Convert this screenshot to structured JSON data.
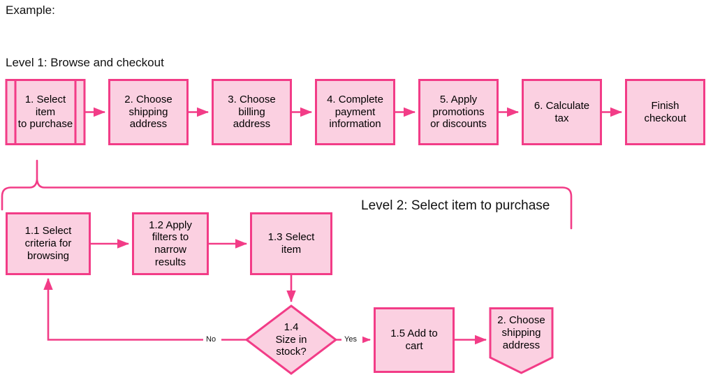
{
  "page": {
    "example_label": "Example:",
    "colors": {
      "shape_fill": "#FBD0E1",
      "shape_stroke": "#F23C87",
      "connector": "#F23C87",
      "text": "#000000",
      "background": "#FFFFFF"
    }
  },
  "level1": {
    "title": "Level 1: Browse and checkout",
    "nodes": [
      {
        "id": "l1-n1",
        "label": "1. Select item\nto purchase",
        "shape": "predefined-process"
      },
      {
        "id": "l1-n2",
        "label": "2. Choose\nshipping\naddress",
        "shape": "process"
      },
      {
        "id": "l1-n3",
        "label": "3. Choose\nbilling\naddress",
        "shape": "process"
      },
      {
        "id": "l1-n4",
        "label": "4. Complete\npayment\ninformation",
        "shape": "process"
      },
      {
        "id": "l1-n5",
        "label": "5. Apply\npromotions\nor discounts",
        "shape": "process"
      },
      {
        "id": "l1-n6",
        "label": "6. Calculate\ntax",
        "shape": "process"
      },
      {
        "id": "l1-n7",
        "label": "Finish\ncheckout",
        "shape": "process"
      }
    ]
  },
  "level2": {
    "title": "Level 2: Select item to purchase",
    "nodes": [
      {
        "id": "l2-n1",
        "label": "1.1 Select\ncriteria for\nbrowsing",
        "shape": "process"
      },
      {
        "id": "l2-n2",
        "label": "1.2 Apply\nfilters to\nnarrow\nresults",
        "shape": "process"
      },
      {
        "id": "l2-n3",
        "label": "1.3 Select\nitem",
        "shape": "process"
      },
      {
        "id": "l2-n4",
        "label": "1.4\nSize in\nstock?",
        "shape": "decision"
      },
      {
        "id": "l2-n5",
        "label": "1.5 Add to\ncart",
        "shape": "process"
      },
      {
        "id": "l2-n6",
        "label": "2. Choose\nshipping\naddress",
        "shape": "off-page-connector"
      }
    ],
    "edge_labels": {
      "no": "No",
      "yes": "Yes"
    }
  }
}
